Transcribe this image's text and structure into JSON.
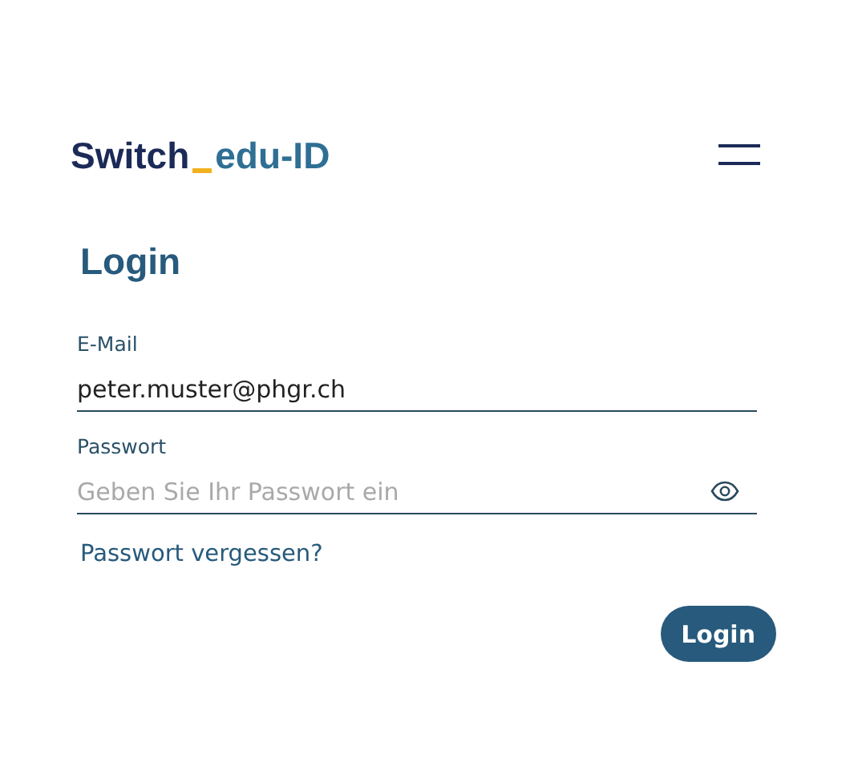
{
  "header": {
    "logo": {
      "brand": "Switch",
      "product": "edu-ID"
    }
  },
  "title": "Login",
  "fields": [
    {
      "kind": "text",
      "label": "E-Mail",
      "value": "peter.muster@phgr.ch"
    },
    {
      "kind": "password",
      "label": "Passwort",
      "placeholder": "Geben Sie Ihr Passwort ein"
    }
  ],
  "forgot_link": "Passwort vergessen?",
  "submit_button": "Login"
}
